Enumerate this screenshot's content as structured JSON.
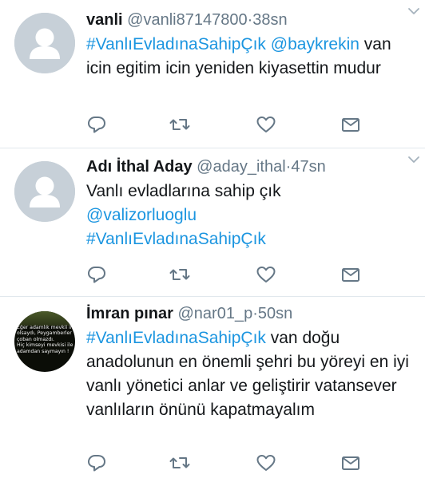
{
  "tweets": [
    {
      "name": "vanli",
      "handle": "@vanli87147800",
      "separator": "·",
      "time": "38sn",
      "segments": [
        {
          "type": "tag",
          "text": "#VanlıEvladınaSahipÇık"
        },
        {
          "type": "text",
          "text": " "
        },
        {
          "type": "mention",
          "text": "@baykrekin"
        },
        {
          "type": "text",
          "text": " van icin egitim icin yeniden kiyasettin mudur"
        }
      ],
      "avatar": "default-avatar-icon"
    },
    {
      "name": "Adı İthal Aday",
      "handle": "@aday_ithal",
      "separator": "·",
      "time": "47sn",
      "segments": [
        {
          "type": "text",
          "text": "Vanlı evladlarına sahip çık"
        },
        {
          "type": "br"
        },
        {
          "type": "mention",
          "text": "@valizorluoglu"
        },
        {
          "type": "br"
        },
        {
          "type": "tag",
          "text": "#VanlıEvladınaSahipÇık"
        }
      ],
      "avatar": "default-avatar-icon"
    },
    {
      "name": "İmran pınar",
      "handle": "@nar01_p",
      "separator": "·",
      "time": "50sn",
      "segments": [
        {
          "type": "tag",
          "text": "#VanlıEvladınaSahipÇık"
        },
        {
          "type": "text",
          "text": " van doğu anadolunun en önemli şehri bu yöreyi en iyi vanlı yönetici anlar ve geliştirir vatansever vanlıların önünü kapatmayalım"
        }
      ],
      "avatar_text": "Eğer adamlık mevkii ile\nolsaydı, Peygamberler\nçoban olmazdı.\nHiç kimseyi mevkisi ile\nadamdan saymayın !"
    }
  ],
  "icons": {
    "reply": "reply-icon",
    "retweet": "retweet-icon",
    "like": "heart-icon",
    "dm": "envelope-icon",
    "menu": "chevron-down-icon"
  },
  "colors": {
    "link": "#1b95e0",
    "secondary": "#657786",
    "divider": "#e1e8ed",
    "avatar_bg": "#c7d0d8"
  }
}
